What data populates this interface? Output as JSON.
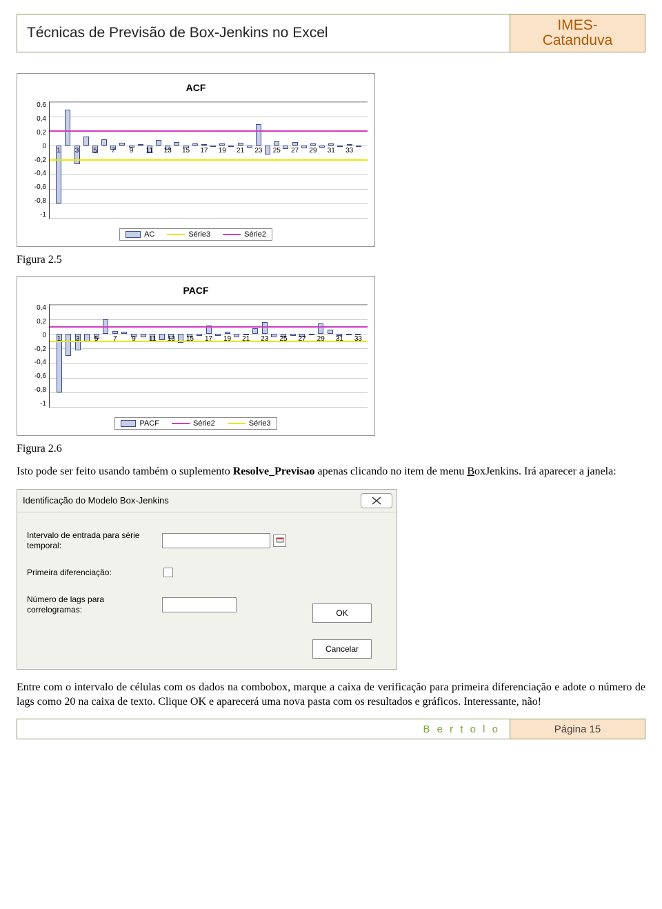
{
  "header": {
    "title": "Técnicas de Previsão de Box-Jenkins no Excel",
    "org_line1": "IMES-",
    "org_line2": "Catanduva"
  },
  "chart_data": [
    {
      "type": "bar",
      "name": "ACF",
      "title": "ACF",
      "x": [
        1,
        2,
        3,
        4,
        5,
        6,
        7,
        8,
        9,
        10,
        11,
        12,
        13,
        14,
        15,
        16,
        17,
        18,
        19,
        20,
        21,
        22,
        23,
        24,
        25,
        26,
        27,
        28,
        29,
        30,
        31,
        32,
        33,
        34
      ],
      "values": [
        -0.8,
        0.5,
        -0.26,
        0.12,
        -0.1,
        0.09,
        -0.06,
        0.04,
        -0.03,
        0.02,
        -0.1,
        0.08,
        -0.06,
        0.05,
        -0.04,
        0.03,
        0.02,
        -0.02,
        0.03,
        -0.02,
        0.04,
        -0.03,
        0.3,
        -0.12,
        0.06,
        -0.05,
        0.05,
        -0.04,
        0.03,
        -0.03,
        0.03,
        -0.02,
        0.02,
        -0.02
      ],
      "ci_upper": 0.2,
      "ci_lower": -0.2,
      "yticks": [
        "0,6",
        "0,4",
        "0,2",
        "0",
        "-0,2",
        "-0,4",
        "-0,6",
        "-0,8",
        "-1"
      ],
      "xlabels_every_two": [
        1,
        3,
        5,
        7,
        9,
        11,
        13,
        15,
        17,
        19,
        21,
        23,
        25,
        27,
        29,
        31,
        33
      ],
      "ylim": [
        -1.0,
        0.6
      ],
      "legend": [
        "AC",
        "Série3",
        "Série2"
      ],
      "legend_colors": {
        "AC": "bar",
        "Série3": "#e8e800",
        "Série2": "#d63ac9"
      }
    },
    {
      "type": "bar",
      "name": "PACF",
      "title": "PACF",
      "x": [
        1,
        2,
        3,
        4,
        5,
        6,
        7,
        8,
        9,
        10,
        11,
        12,
        13,
        14,
        15,
        16,
        17,
        18,
        19,
        20,
        21,
        22,
        23,
        24,
        25,
        26,
        27,
        28,
        29,
        30,
        31,
        32,
        33
      ],
      "values": [
        -0.8,
        -0.3,
        -0.22,
        -0.1,
        -0.06,
        0.2,
        0.04,
        0.03,
        -0.04,
        -0.04,
        -0.1,
        -0.08,
        -0.06,
        -0.12,
        -0.04,
        -0.03,
        0.12,
        -0.03,
        0.03,
        -0.04,
        -0.02,
        0.08,
        0.16,
        -0.04,
        -0.04,
        -0.03,
        -0.04,
        -0.02,
        0.14,
        0.06,
        -0.03,
        -0.02,
        -0.02
      ],
      "ci_upper": 0.1,
      "ci_lower": -0.1,
      "yticks": [
        "0,4",
        "0,2",
        "0",
        "-0,2",
        "-0,4",
        "-0,6",
        "-0,8",
        "-1"
      ],
      "xlabels_every_two": [
        1,
        3,
        5,
        7,
        9,
        11,
        13,
        15,
        17,
        19,
        21,
        23,
        25,
        27,
        29,
        31,
        33
      ],
      "ylim": [
        -1.0,
        0.4
      ],
      "legend": [
        "PACF",
        "Série2",
        "Série3"
      ],
      "legend_colors": {
        "PACF": "bar",
        "Série2": "#d63ac9",
        "Série3": "#e8e800"
      }
    }
  ],
  "captions": {
    "fig25": "Figura 2.5",
    "fig26": "Figura 2.6"
  },
  "para1_a": "Isto pode ser feito usando também o suplemento ",
  "para1_bold": "Resolve_Previsao",
  "para1_b": " apenas clicando no item de menu ",
  "para1_u": "B",
  "para1_c": "oxJenkins. Irá aparecer a janela:",
  "dialog": {
    "title": "Identificação do Modelo Box-Jenkins",
    "field_interval": "Intervalo de entrada para série temporal:",
    "field_diff": "Primeira diferenciação:",
    "field_lags": "Número de lags para correlogramas:",
    "ok": "OK",
    "cancel": "Cancelar"
  },
  "para2": "Entre com o intervalo de células com os dados na combobox, marque a caixa de verificação para primeira diferenciação e adote o número de lags como 20 na caixa de texto. Clique OK e aparecerá uma nova pasta com os resultados e gráficos. Interessante, não!",
  "footer": {
    "author": "B e r t o l o",
    "page": "Página 15"
  }
}
